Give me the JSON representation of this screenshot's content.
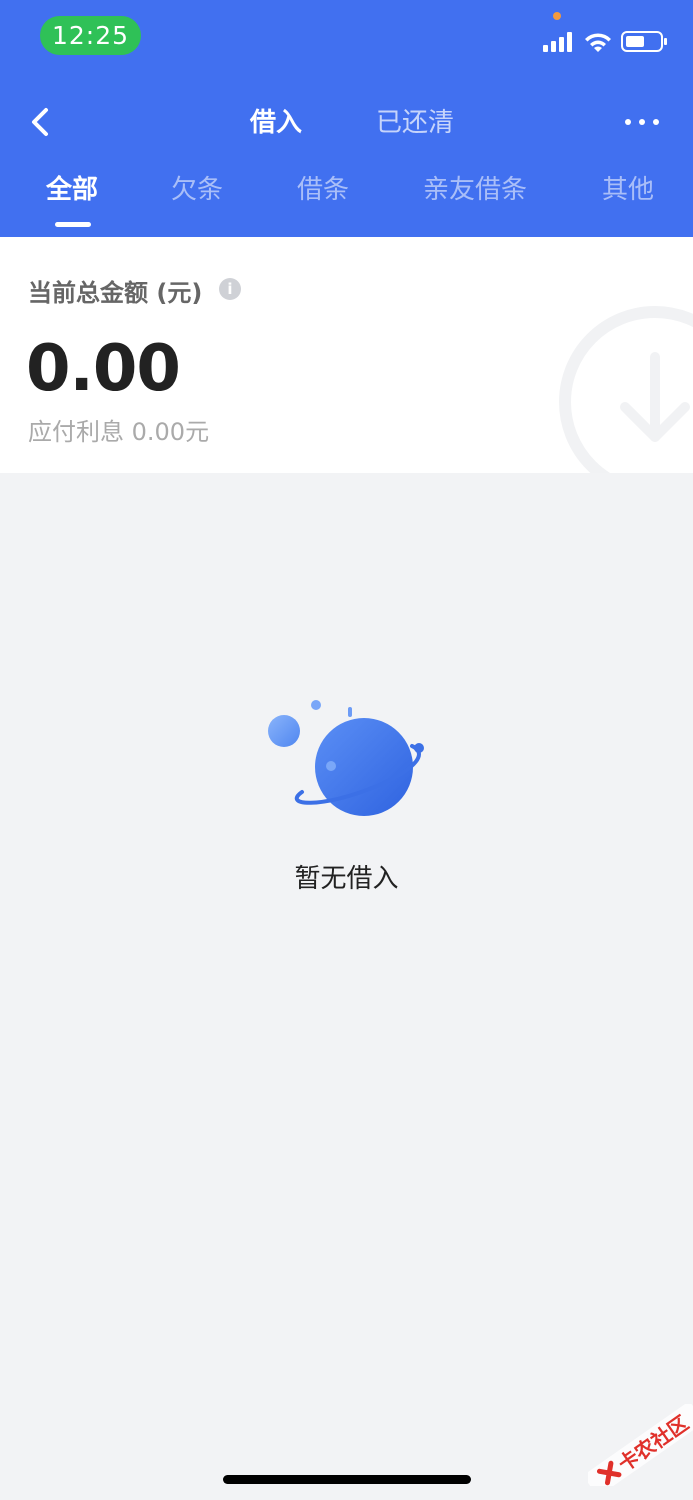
{
  "status_bar": {
    "time": "12:25"
  },
  "nav": {
    "tabs": [
      {
        "label": "借入",
        "active": true
      },
      {
        "label": "已还清",
        "active": false
      }
    ]
  },
  "categories": [
    {
      "label": "全部",
      "active": true
    },
    {
      "label": "欠条",
      "active": false
    },
    {
      "label": "借条",
      "active": false
    },
    {
      "label": "亲友借条",
      "active": false
    },
    {
      "label": "其他",
      "active": false
    }
  ],
  "summary": {
    "label": "当前总金额 (元)",
    "info_icon": "i",
    "amount": "0.00",
    "interest": "应付利息 0.00元"
  },
  "empty_state": {
    "text": "暂无借入"
  },
  "watermark": {
    "text": "卡农社区"
  },
  "colors": {
    "header": "#4170f0",
    "status_pill": "#2fc157",
    "background": "#f2f3f5"
  }
}
